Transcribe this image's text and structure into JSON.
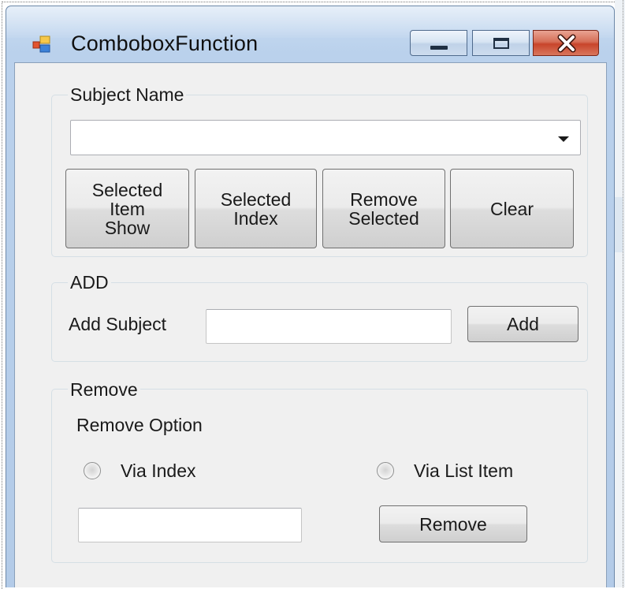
{
  "window": {
    "title": "ComboboxFunction",
    "icons": {
      "app": "winforms-app-icon",
      "minimize": "minimize-icon",
      "maximize": "maximize-icon",
      "close": "close-icon"
    }
  },
  "subject_group": {
    "legend": "Subject Name",
    "combobox": {
      "selected_value": "",
      "icon": "chevron-down-icon"
    },
    "buttons": {
      "selected_item_show": "Selected\nItem\nShow",
      "selected_index": "Selected\nIndex",
      "remove_selected": "Remove\nSelected",
      "clear": "Clear"
    }
  },
  "add_group": {
    "legend": "ADD",
    "label": "Add Subject",
    "input_value": "",
    "button": "Add"
  },
  "remove_group": {
    "legend": "Remove",
    "option_label": "Remove Option",
    "radio_via_index": "Via Index",
    "radio_via_list_item": "Via List Item",
    "input_value": "",
    "button": "Remove"
  },
  "colors": {
    "form_background": "#f0f0f0",
    "window_frame": "#b3cbe8",
    "close_button": "#c8452b"
  }
}
